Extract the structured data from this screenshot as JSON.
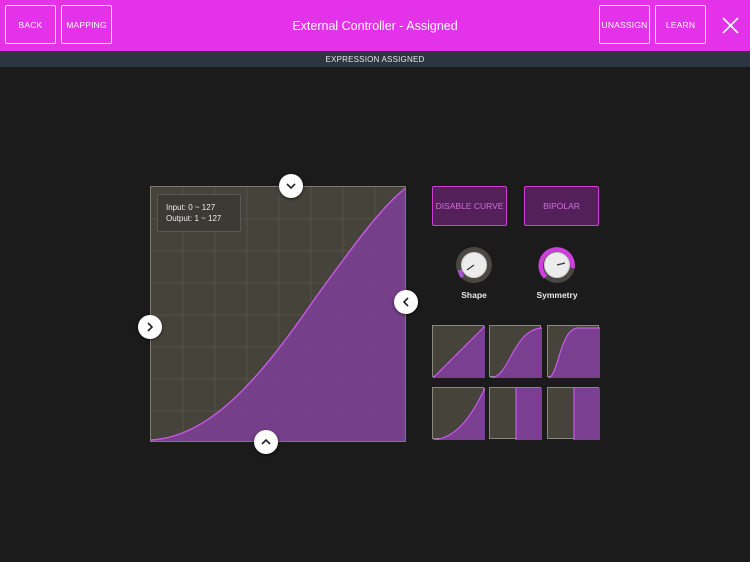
{
  "header": {
    "title": "External Controller - Assigned",
    "back_label": "BACK",
    "mapping_label": "MAPPING",
    "unassign_label": "UNASSIGN",
    "learn_label": "LEARN"
  },
  "status": {
    "text": "EXPRESSION ASSIGNED"
  },
  "curve": {
    "input_text": "Input: 0 ~ 127",
    "output_text": "Output: 1 ~ 127"
  },
  "buttons": {
    "disable_curve_label": "DISABLE CURVE",
    "bipolar_label": "BIPOLAR"
  },
  "knobs": {
    "shape_label": "Shape",
    "symmetry_label": "Symmetry"
  },
  "presets": [
    {
      "name": "linear"
    },
    {
      "name": "s-curve-soft"
    },
    {
      "name": "s-curve-wide"
    },
    {
      "name": "exponential"
    },
    {
      "name": "step-late"
    },
    {
      "name": "step-mid"
    }
  ],
  "colors": {
    "accent": "#e332ea",
    "status_bar": "#2d3442",
    "graph_bg": "#46433b",
    "curve_fill": "#7b3f91",
    "curve_line": "#b24fd6"
  },
  "icons": {
    "close": "close-icon",
    "arrow_down": "chevron-down-icon",
    "arrow_up": "chevron-up-icon",
    "arrow_left": "chevron-left-icon",
    "arrow_right": "chevron-right-icon"
  }
}
